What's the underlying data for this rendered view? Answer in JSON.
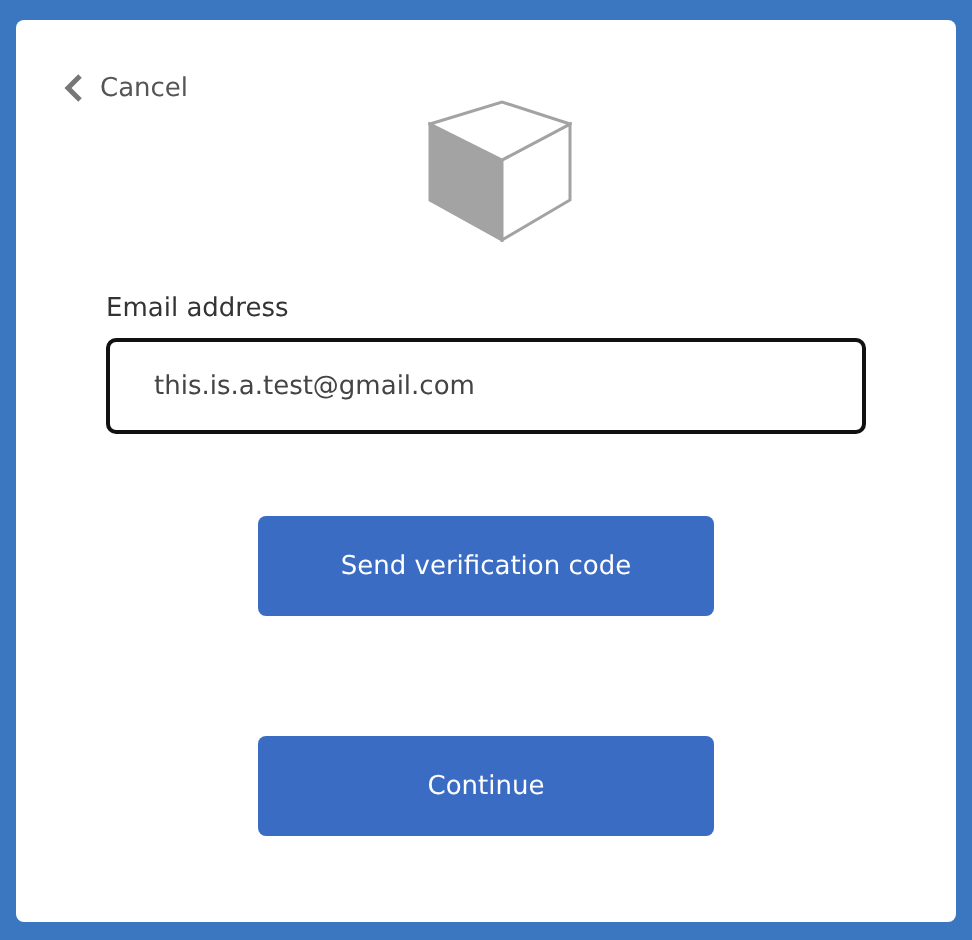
{
  "cancel_link": {
    "label": "Cancel"
  },
  "email": {
    "label": "Email address",
    "value": "this.is.a.test@gmail.com"
  },
  "buttons": [
    {
      "label": "Send verification code"
    },
    {
      "label": "Continue"
    }
  ]
}
